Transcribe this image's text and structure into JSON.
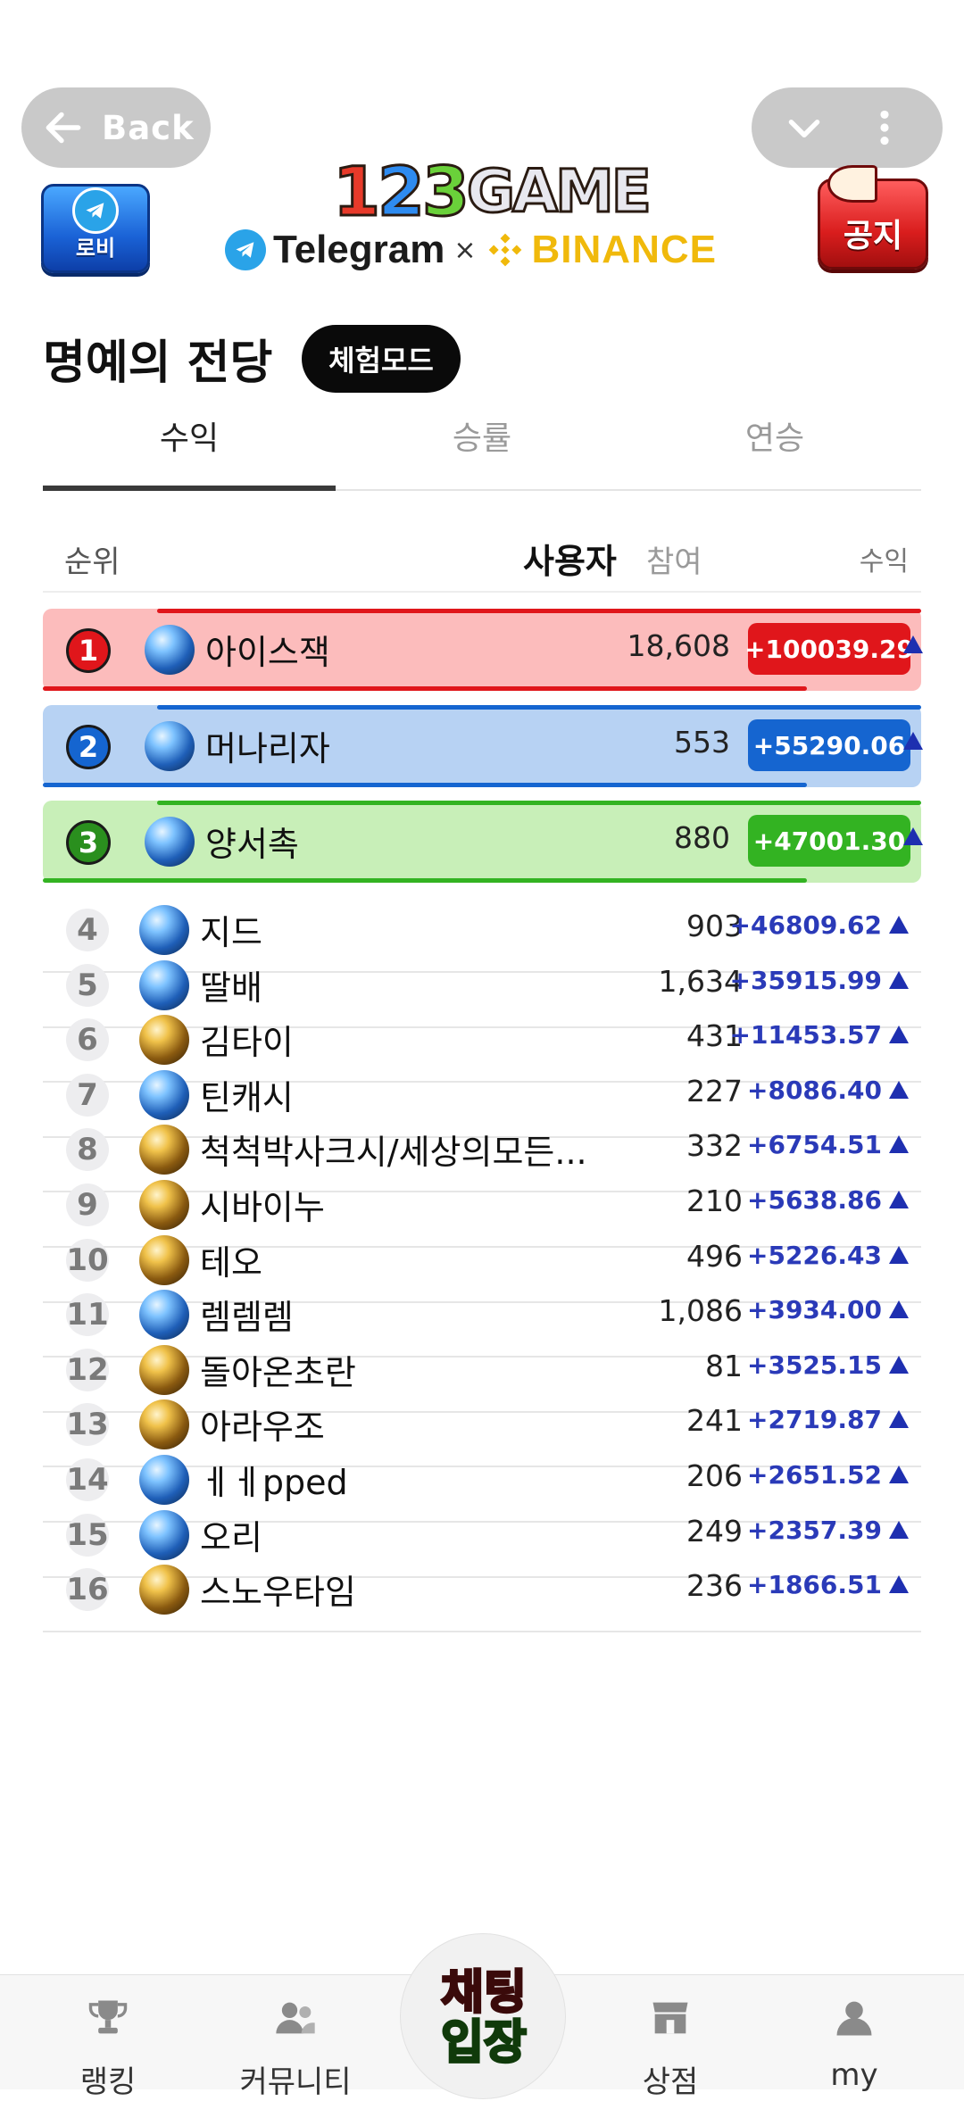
{
  "top_bar": {
    "back_label": "Back"
  },
  "header": {
    "lobby_label": "로비",
    "notice_label": "공지",
    "logo": {
      "d1": "1",
      "d2": "2",
      "d3": "3",
      "word": "GAME"
    },
    "partner_left": "Telegram",
    "partner_sep": "×",
    "partner_right": "BINANCE"
  },
  "page": {
    "title": "명예의 전당",
    "mode_badge": "체험모드"
  },
  "tabs": [
    {
      "label": "수익",
      "active": true
    },
    {
      "label": "승률",
      "active": false
    },
    {
      "label": "연승",
      "active": false
    }
  ],
  "table_header": {
    "rank": "순위",
    "user": "사용자",
    "participation": "참여",
    "profit": "수익"
  },
  "colors": {
    "rank1_bg": "#fcbcbc",
    "rank1_line": "#e0161b",
    "rank1_badge": "#e0161b",
    "rank2_bg": "#b7d2f3",
    "rank2_line": "#1565d0",
    "rank2_badge": "#1565d0",
    "rank3_bg": "#c8efb8",
    "rank3_line": "#33b322",
    "rank3_badge": "#2a8f1e",
    "profit_text": "#2a3ab8"
  },
  "podium": [
    {
      "rank": "1",
      "name": "아이스잭",
      "participation": "18,608",
      "profit": "+100039.29",
      "avatar": "blue"
    },
    {
      "rank": "2",
      "name": "머나리자",
      "participation": "553",
      "profit": "+55290.06",
      "avatar": "blue"
    },
    {
      "rank": "3",
      "name": "양서촉",
      "participation": "880",
      "profit": "+47001.30",
      "avatar": "blue"
    }
  ],
  "rows": [
    {
      "rank": "4",
      "name": "지드",
      "participation": "903",
      "profit": "+46809.62",
      "avatar": "blue"
    },
    {
      "rank": "5",
      "name": "딸배",
      "participation": "1,634",
      "profit": "+35915.99",
      "avatar": "blue"
    },
    {
      "rank": "6",
      "name": "김타이",
      "participation": "431",
      "profit": "+11453.57",
      "avatar": "gold"
    },
    {
      "rank": "7",
      "name": "틴캐시",
      "participation": "227",
      "profit": "+8086.40",
      "avatar": "blue"
    },
    {
      "rank": "8",
      "name": "척척박사크시/세상의모든...",
      "participation": "332",
      "profit": "+6754.51",
      "avatar": "gold"
    },
    {
      "rank": "9",
      "name": "시바이누",
      "participation": "210",
      "profit": "+5638.86",
      "avatar": "gold"
    },
    {
      "rank": "10",
      "name": "테오",
      "participation": "496",
      "profit": "+5226.43",
      "avatar": "gold"
    },
    {
      "rank": "11",
      "name": "렘렘렘",
      "participation": "1,086",
      "profit": "+3934.00",
      "avatar": "blue"
    },
    {
      "rank": "12",
      "name": "돌아온초란",
      "participation": "81",
      "profit": "+3525.15",
      "avatar": "gold"
    },
    {
      "rank": "13",
      "name": "아라우조",
      "participation": "241",
      "profit": "+2719.87",
      "avatar": "gold"
    },
    {
      "rank": "14",
      "name": "ㅔㅔpped",
      "participation": "206",
      "profit": "+2651.52",
      "avatar": "blue"
    },
    {
      "rank": "15",
      "name": "오리",
      "participation": "249",
      "profit": "+2357.39",
      "avatar": "blue"
    },
    {
      "rank": "16",
      "name": "스노우타임",
      "participation": "236",
      "profit": "+1866.51",
      "avatar": "gold"
    }
  ],
  "bottom_nav": {
    "ranking": "랭킹",
    "community": "커뮤니티",
    "chat_line1": "채팅",
    "chat_line2": "입장",
    "shop": "상점",
    "my": "my"
  }
}
